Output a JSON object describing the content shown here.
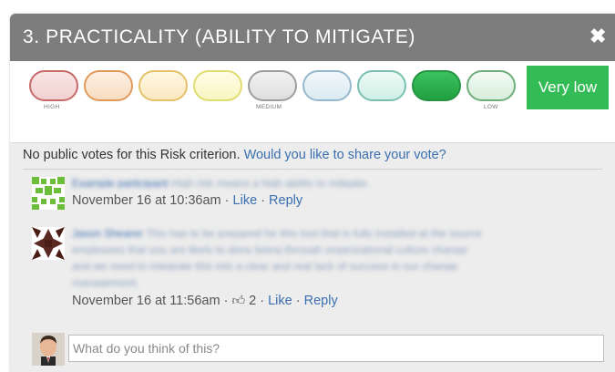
{
  "modal": {
    "title": "3. PRACTICALITY (ABILITY TO MITIGATE)",
    "close_icon": "close-icon"
  },
  "scale": {
    "labels": {
      "high": "HIGH",
      "medium": "MEDIUM",
      "low": "LOW"
    },
    "selected_label": "Very low",
    "colors": {
      "pill_1": "#d98a8a",
      "pill_2": "#e8b07a",
      "pill_3": "#eed08a",
      "pill_4": "#e8e58a",
      "pill_5": "#b3b3b3",
      "pill_6": "#a8c7d8",
      "pill_7": "#8ccfc0",
      "pill_8": "#2fae4e",
      "pill_9": "#8fc99a",
      "selected": "#33bb55"
    }
  },
  "comments": {
    "no_votes_text": "No public votes for this Risk criterion.",
    "share_link": "Would you like to share your vote?",
    "items": [
      {
        "author": "Example participant",
        "text": "High risk means a high ability to mitigate.",
        "date": "November 16 at 10:36am",
        "like_label": "Like",
        "reply_label": "Reply"
      },
      {
        "author": "Jason Shearer",
        "text_lines": [
          "This has to be prepared for this tool that is fully installed at the source",
          "employees that you are likely to deny being through organizational culture change",
          "and we need to integrate this into a clear and real lack of success in our change",
          "management."
        ],
        "date": "November 16 at 11:56am",
        "likes": "2",
        "like_label": "Like",
        "reply_label": "Reply"
      }
    ],
    "separator": "·"
  },
  "compose": {
    "placeholder": "What do you think of this?"
  }
}
